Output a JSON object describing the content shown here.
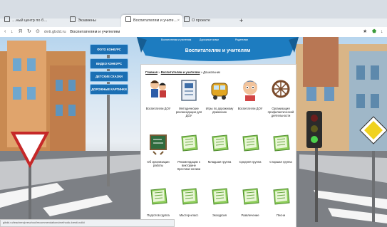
{
  "tabs": [
    {
      "label": "…ный центр по б…",
      "active": false
    },
    {
      "label": "Экзамены",
      "active": false
    },
    {
      "label": "Воспитателям и учите…",
      "active": true
    },
    {
      "label": "О проекте",
      "active": false
    }
  ],
  "new_tab": "+",
  "address": {
    "domain": "deti.gbdd.ru",
    "title": "Воспитателям и учителям"
  },
  "side_menu": [
    "ФОТО КОНКУРС",
    "ВИДЕО КОНКУРС",
    "ДЕТСКИЕ СКАЗКИ",
    "ДОРОЖНЫЕ КАРТИНКИ"
  ],
  "banner": {
    "title": "Воспитателям и учителям",
    "top_links": [
      "Воспитателям и учителям",
      "Дорожные знаки",
      "Родителям"
    ]
  },
  "breadcrumb": {
    "home": "Главная",
    "section": "Воспитателям и учителям",
    "current": "Дошкольник"
  },
  "row1": [
    {
      "label": "Воспитатели ДОУ",
      "icon": "children-icon"
    },
    {
      "label": "Методические рекомендации для ДОУ",
      "icon": "book-icon"
    },
    {
      "label": "Игры по дорожному движению",
      "icon": "bus-icon"
    },
    {
      "label": "Воспитатели ДОУ",
      "icon": "boy-icon"
    },
    {
      "label": "Организация профилактической деятельности",
      "icon": "wheel-icon"
    }
  ],
  "row2": [
    {
      "label": "Об организации работы",
      "icon": "chalkboard-icon"
    },
    {
      "label": "Рекомендации к викторине Крестики-нолики",
      "icon": "folder-icon"
    },
    {
      "label": "Младшая группа",
      "icon": "folder-icon"
    },
    {
      "label": "Средняя группа",
      "icon": "folder-icon"
    },
    {
      "label": "Старшая группа",
      "icon": "folder-icon"
    }
  ],
  "row3": [
    {
      "label": "Подготов группа",
      "icon": "folder-icon"
    },
    {
      "label": "Мастер-класс",
      "icon": "folder-icon"
    },
    {
      "label": "Экскурсия",
      "icon": "folder-icon"
    },
    {
      "label": "Развлечение",
      "icon": "folder-icon"
    },
    {
      "label": "Песни",
      "icon": "folder-icon"
    }
  ],
  "status_url": "gibdd.ru/teachers/preschool/recommendations/methodic-kresti-noliki"
}
